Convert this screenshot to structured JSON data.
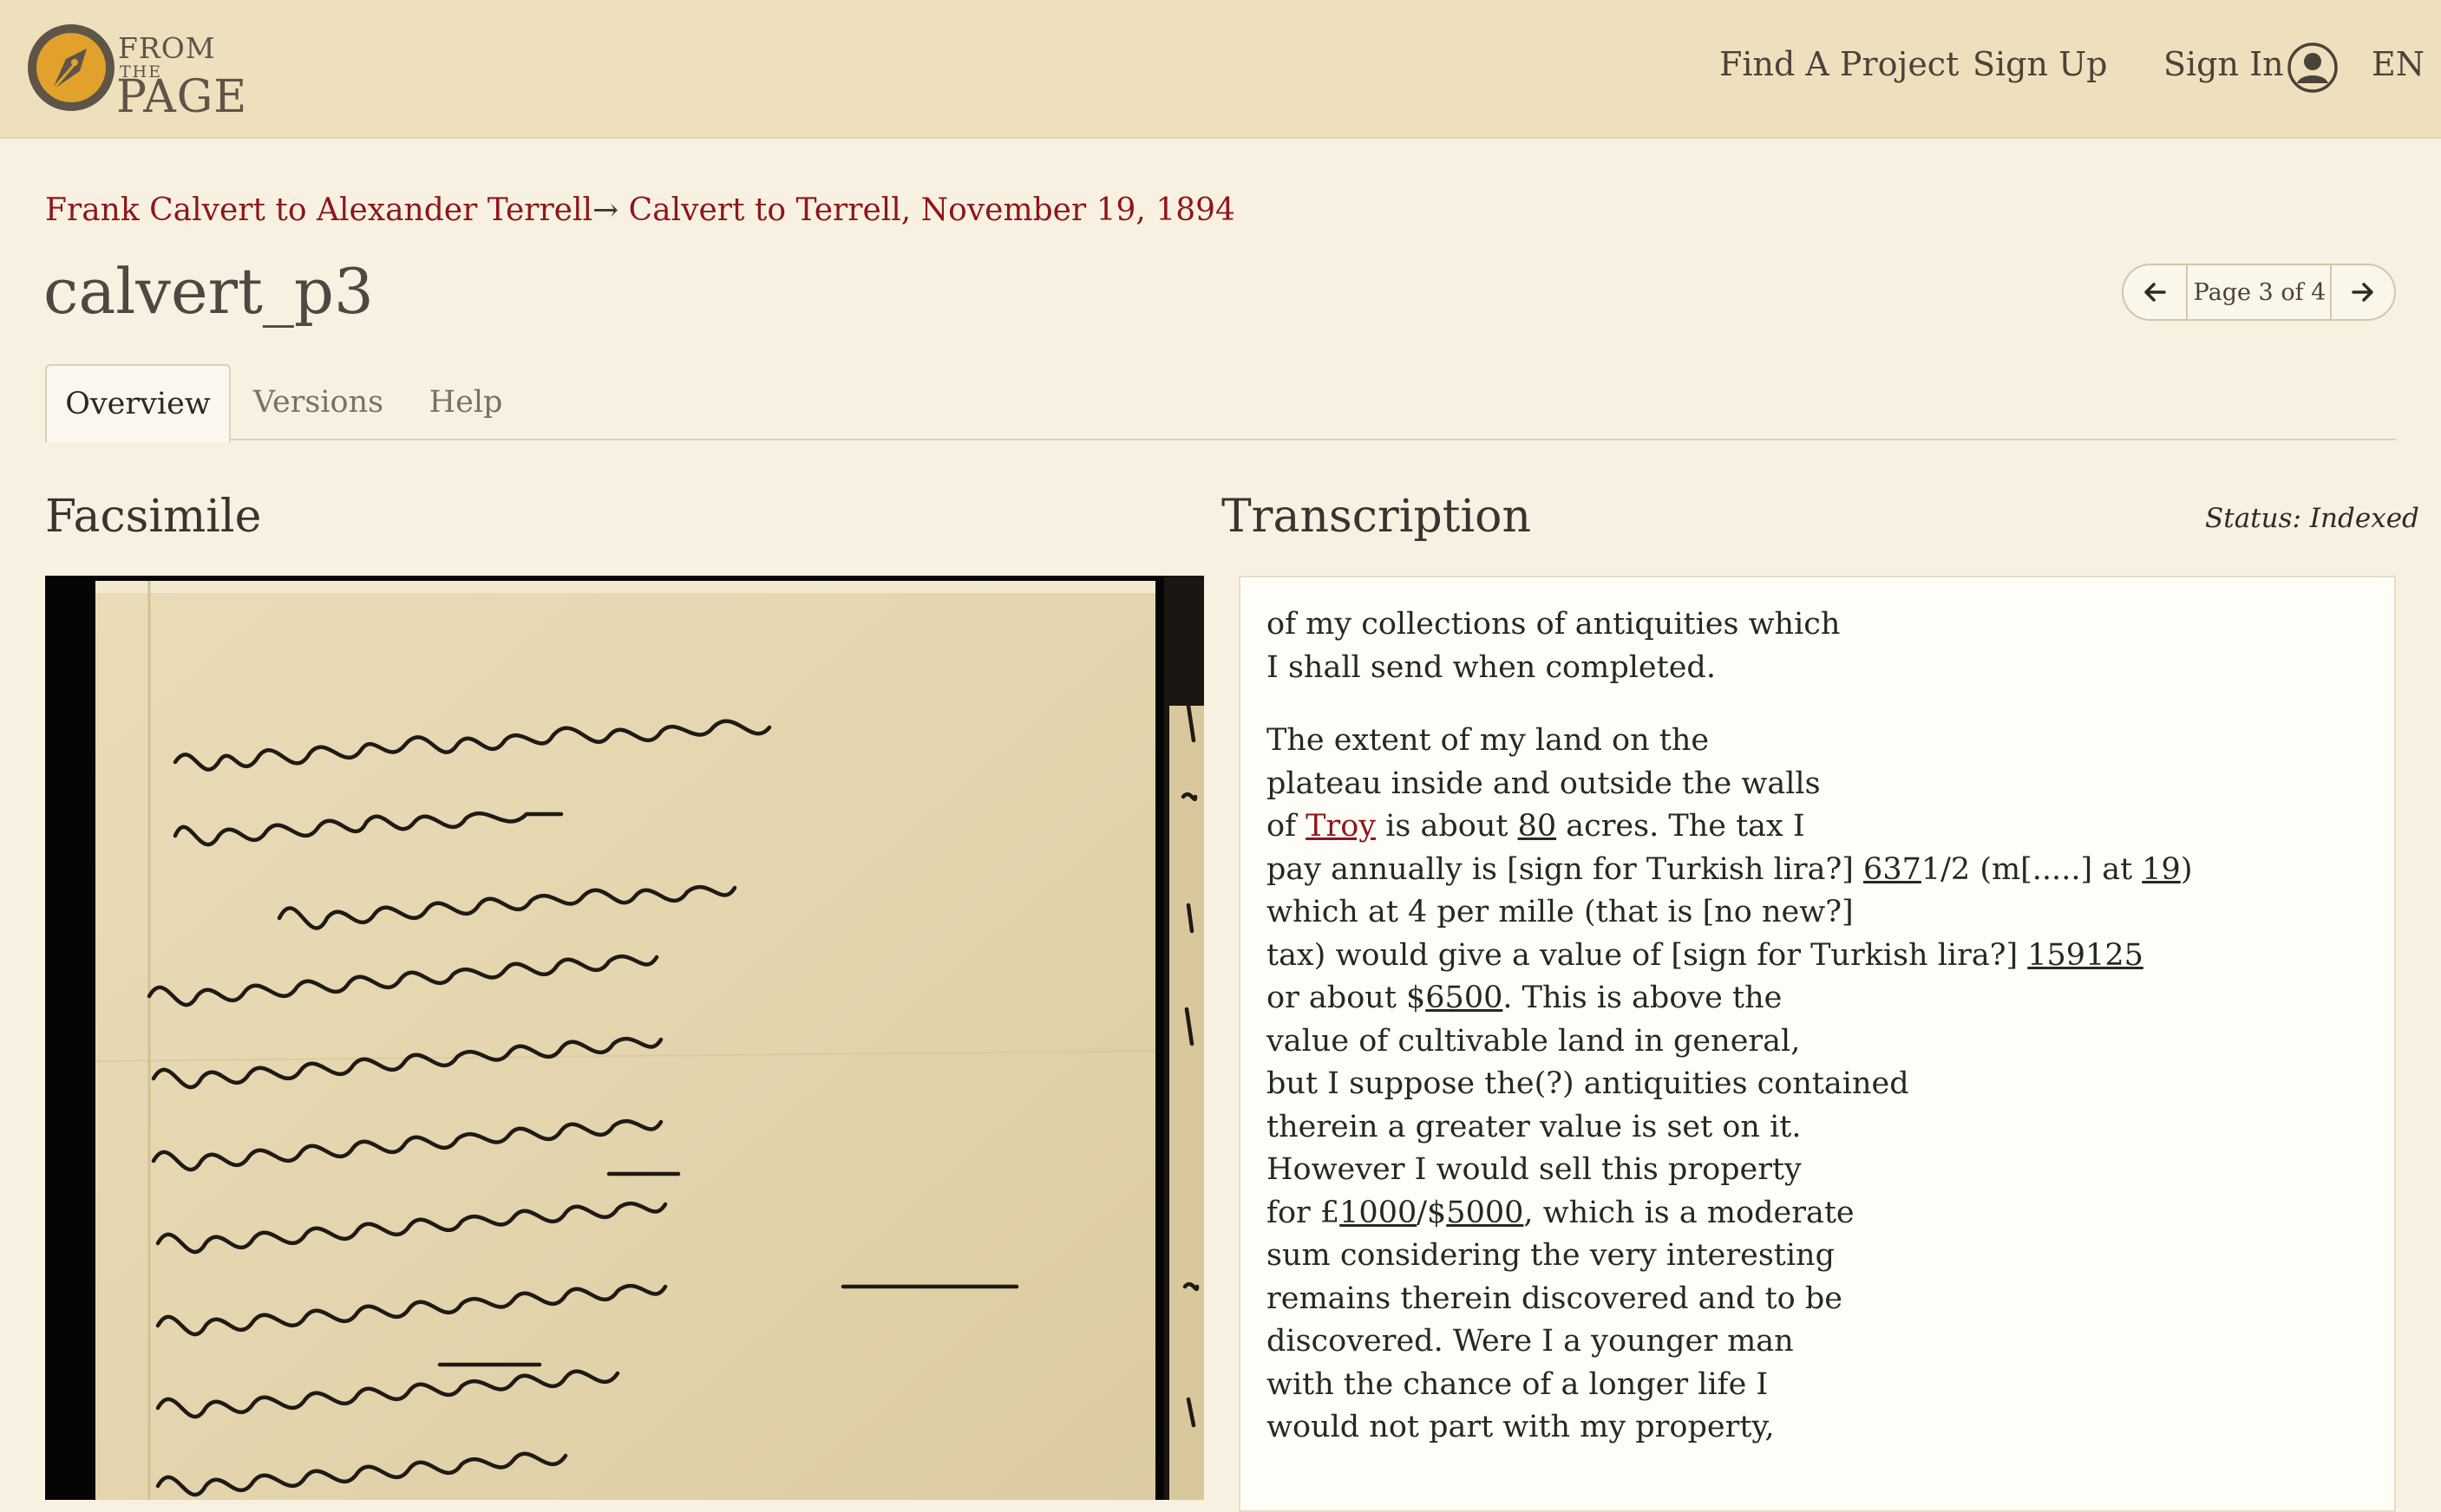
{
  "header": {
    "logo_from": "FROM",
    "logo_the": "THE",
    "logo_page": "PAGE",
    "nav": {
      "find_project": "Find A Project",
      "sign_up": "Sign Up",
      "sign_in": "Sign In",
      "language": "EN"
    }
  },
  "breadcrumb": {
    "collection": "Frank Calvert to Alexander Terrell",
    "separator": "→",
    "work": "Calvert to Terrell, November 19, 1894"
  },
  "page_title": "calvert_p3",
  "pager": {
    "label": "Page 3 of 4"
  },
  "tabs": {
    "overview": "Overview",
    "versions": "Versions",
    "help": "Help"
  },
  "facsimile": {
    "heading": "Facsimile"
  },
  "transcription": {
    "heading": "Transcription",
    "status": "Status: Indexed",
    "p1": [
      "of my collections of antiquities which",
      "I shall send when completed."
    ],
    "p2": {
      "l1": "The extent of my land on the",
      "l2": "plateau inside and outside the walls",
      "l3_a": "of ",
      "l3_link": "Troy",
      "l3_b": " is about ",
      "l3_u": "80",
      "l3_c": " acres. The tax I",
      "l4_a": "pay annually is [sign for Turkish lira?] ",
      "l4_u1": "637",
      "l4_b": "1/2 (m[.....] at ",
      "l4_u2": "19",
      "l4_c": ")",
      "l5": "which at 4 per mille (that is [no new?]",
      "l6_a": "tax) would give a value of [sign for Turkish lira?] ",
      "l6_u": "159125",
      "l7_a": "or about $",
      "l7_u": "6500",
      "l7_b": ". This is above the",
      "l8": "value of cultivable land in general,",
      "l9": "but I suppose the(?) antiquities contained",
      "l10": "therein a greater value is set on it.",
      "l11": "However I would sell this property",
      "l12_a": "for £",
      "l12_u1": "1000",
      "l12_b": "/$",
      "l12_u2": "5000",
      "l12_c": ", which is a moderate",
      "l13": "sum considering the very interesting",
      "l14": "remains therein discovered and to be",
      "l15": "discovered. Were I a younger man",
      "l16": "with the chance of a longer life I",
      "l17": "would not part with my property,"
    }
  }
}
